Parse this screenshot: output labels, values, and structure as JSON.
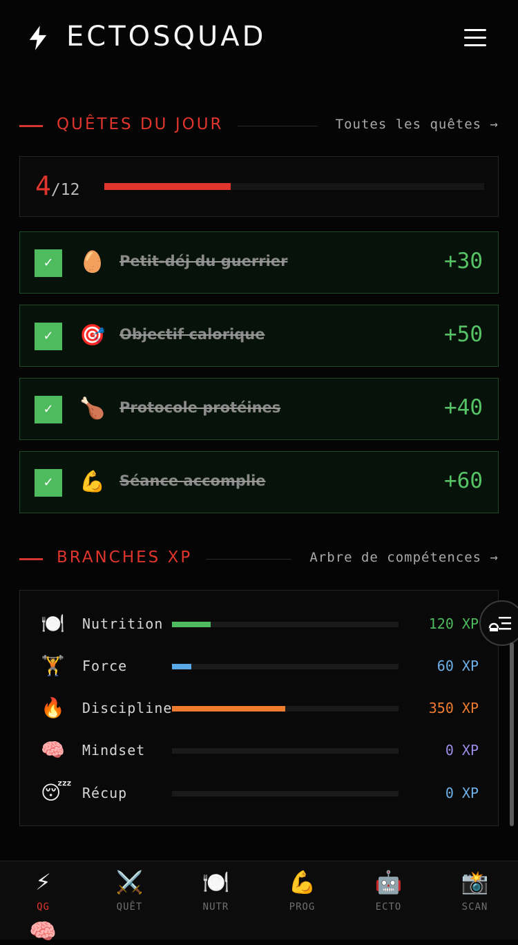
{
  "app": {
    "title": "ECTOSQUAD"
  },
  "quests_section": {
    "title": "QUÊTES DU JOUR",
    "link": "Toutes les quêtes →"
  },
  "progress": {
    "done": "4",
    "total": "/12",
    "fraction": 0.333
  },
  "quests": [
    {
      "emoji": "🥚",
      "label": "Petit-déj du guerrier",
      "xp": "+30"
    },
    {
      "emoji": "🎯",
      "label": "Objectif calorique",
      "xp": "+50"
    },
    {
      "emoji": "🍗",
      "label": "Protocole protéines",
      "xp": "+40"
    },
    {
      "emoji": "💪",
      "label": "Séance accomplie",
      "xp": "+60"
    }
  ],
  "branches_section": {
    "title": "BRANCHES XP",
    "link": "Arbre de compétences →"
  },
  "branches": [
    {
      "emoji": "🍽️",
      "label": "Nutrition",
      "xp": "120 XP",
      "fraction": 0.17,
      "color": "#4dbb5e",
      "xp_color": "#4dbb5e"
    },
    {
      "emoji": "🏋️",
      "label": "Force",
      "xp": "60 XP",
      "fraction": 0.085,
      "color": "#5aa8e6",
      "xp_color": "#6fb0e8"
    },
    {
      "emoji": "🔥",
      "label": "Discipline",
      "xp": "350 XP",
      "fraction": 0.5,
      "color": "#f07c2f",
      "xp_color": "#f07c2f"
    },
    {
      "emoji": "🧠",
      "label": "Mindset",
      "xp": "0 XP",
      "fraction": 0,
      "color": "#b48cf0",
      "xp_color": "#9c8ce8"
    },
    {
      "emoji": "😴",
      "label": "Récup",
      "xp": "0 XP",
      "fraction": 0,
      "color": "#6fb0e8",
      "xp_color": "#6fb0e8"
    }
  ],
  "nav": [
    {
      "icon": "⚡",
      "label": "QG",
      "active": true
    },
    {
      "icon": "⚔️",
      "label": "QUÊT",
      "active": false
    },
    {
      "icon": "🍽️",
      "label": "NUTR",
      "active": false
    },
    {
      "icon": "💪",
      "label": "PROG",
      "active": false
    },
    {
      "icon": "🤖",
      "label": "ECTO",
      "active": false
    },
    {
      "icon": "📸",
      "label": "SCAN",
      "active": false
    }
  ],
  "floating": {
    "brain_emoji": "🧠"
  },
  "colors": {
    "accent": "#e0352d",
    "success": "#4dbb5e",
    "bg": "#050505"
  }
}
